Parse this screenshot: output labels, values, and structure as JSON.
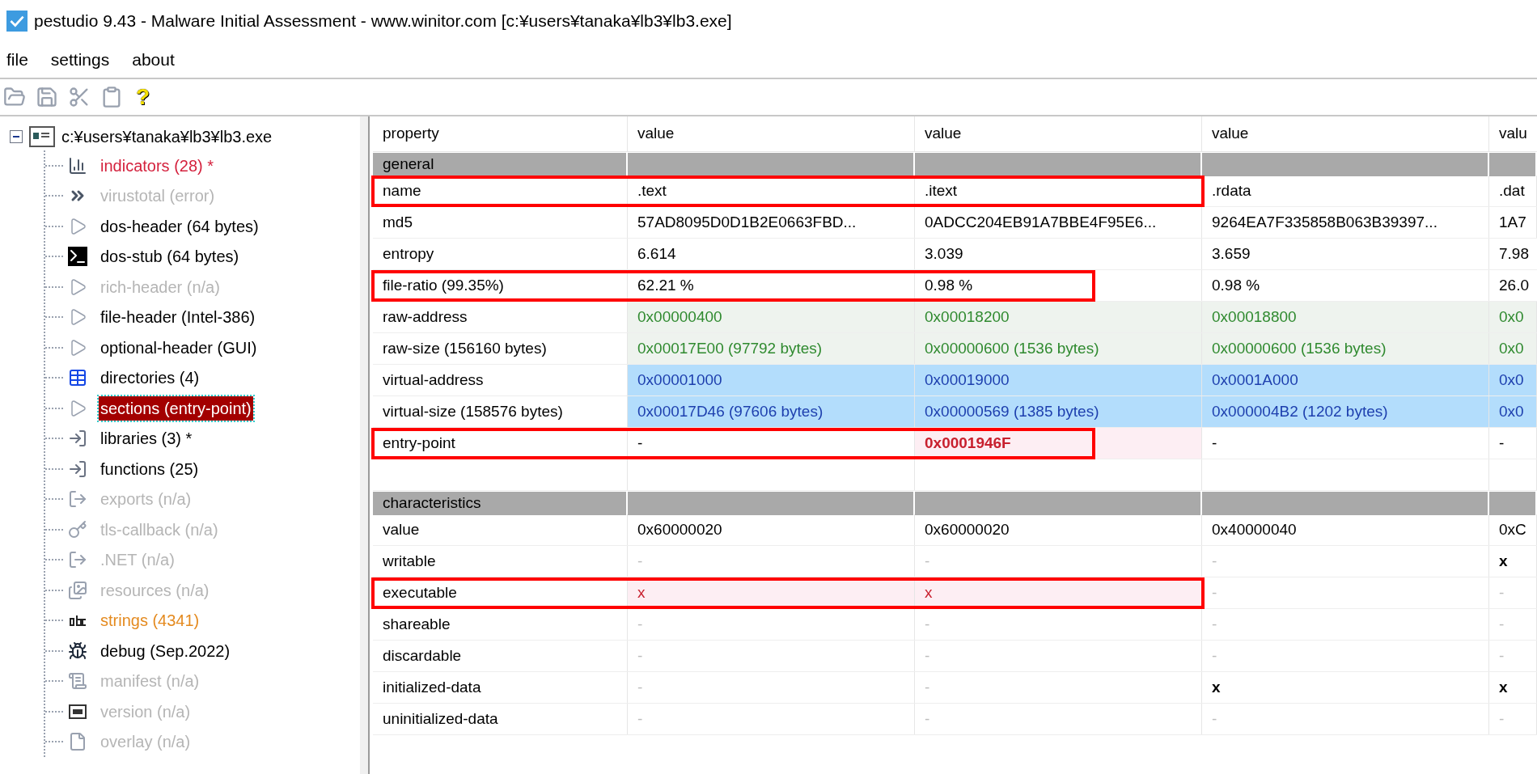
{
  "window": {
    "title": "pestudio 9.43 - Malware Initial Assessment - www.winitor.com [c:¥users¥tanaka¥lb3¥lb3.exe]"
  },
  "menu": [
    "file",
    "settings",
    "about"
  ],
  "toolbar": {
    "help_glyph": "?"
  },
  "tree": {
    "root": {
      "label": "c:¥users¥tanaka¥lb3¥lb3.exe",
      "expanded": true
    },
    "items": [
      {
        "label": "indicators (28) *",
        "kind": "chart",
        "color": "#d4213d",
        "selected": false
      },
      {
        "label": "virustotal (error)",
        "kind": "chevrons",
        "color": "#b5b5b5",
        "selected": false
      },
      {
        "label": "dos-header (64 bytes)",
        "kind": "expander",
        "color": "#000000",
        "selected": false
      },
      {
        "label": "dos-stub (64 bytes)",
        "kind": "console",
        "color": "#000000",
        "selected": false
      },
      {
        "label": "rich-header (n/a)",
        "kind": "expander",
        "color": "#b5b5b5",
        "selected": false
      },
      {
        "label": "file-header (Intel-386)",
        "kind": "expander",
        "color": "#000000",
        "selected": false
      },
      {
        "label": "optional-header (GUI)",
        "kind": "expander",
        "color": "#000000",
        "selected": false
      },
      {
        "label": "directories (4)",
        "kind": "grid",
        "color": "#000000",
        "selected": false
      },
      {
        "label": "sections (entry-point)",
        "kind": "expander",
        "selected": true
      },
      {
        "label": "libraries (3) *",
        "kind": "import",
        "color": "#000000",
        "selected": false
      },
      {
        "label": "functions (25)",
        "kind": "import",
        "color": "#000000",
        "selected": false
      },
      {
        "label": "exports (n/a)",
        "kind": "export",
        "color": "#b5b5b5",
        "selected": false
      },
      {
        "label": "tls-callback (n/a)",
        "kind": "key",
        "color": "#b5b5b5",
        "selected": false
      },
      {
        "label": ".NET (n/a)",
        "kind": "export",
        "color": "#b5b5b5",
        "selected": false
      },
      {
        "label": "resources (n/a)",
        "kind": "resources",
        "color": "#b5b5b5",
        "selected": false
      },
      {
        "label": "strings (4341)",
        "kind": "text",
        "color": "#e48a1f",
        "selected": false
      },
      {
        "label": "debug (Sep.2022)",
        "kind": "bug",
        "color": "#000000",
        "selected": false
      },
      {
        "label": "manifest (n/a)",
        "kind": "scroll",
        "color": "#b5b5b5",
        "selected": false
      },
      {
        "label": "version (n/a)",
        "kind": "version",
        "color": "#b5b5b5",
        "selected": false
      },
      {
        "label": "overlay (n/a)",
        "kind": "page",
        "color": "#b5b5b5",
        "selected": false
      }
    ]
  },
  "table": {
    "columns": [
      "property",
      "value",
      "value",
      "value",
      "valu"
    ],
    "rows": [
      {
        "kind": "group",
        "property": "general"
      },
      {
        "kind": "plain",
        "property": "name",
        "boxed": true,
        "wide": true,
        "cells": [
          {
            "text": ".text",
            "kind": "plain"
          },
          {
            "text": ".itext",
            "kind": "plain"
          },
          {
            "text": ".rdata",
            "kind": "plain"
          },
          {
            "text": ".dat",
            "kind": "plain"
          }
        ]
      },
      {
        "kind": "plain",
        "property": "md5",
        "boxed": false,
        "cells": [
          {
            "text": "57AD8095D0D1B2E0663FBD...",
            "kind": "plain"
          },
          {
            "text": "0ADCC204EB91A7BBE4F95E6...",
            "kind": "plain"
          },
          {
            "text": "9264EA7F335858B063B39397...",
            "kind": "plain"
          },
          {
            "text": "1A7",
            "kind": "plain"
          }
        ]
      },
      {
        "kind": "plain",
        "property": "entropy",
        "boxed": false,
        "cells": [
          {
            "text": "6.614",
            "kind": "plain"
          },
          {
            "text": "3.039",
            "kind": "plain"
          },
          {
            "text": "3.659",
            "kind": "plain"
          },
          {
            "text": "7.98",
            "kind": "plain"
          }
        ]
      },
      {
        "kind": "plain",
        "property": "file-ratio (99.35%)",
        "boxed": true,
        "wide": false,
        "cells": [
          {
            "text": "62.21 %",
            "kind": "plain"
          },
          {
            "text": "0.98 %",
            "kind": "plain"
          },
          {
            "text": "0.98 %",
            "kind": "plain"
          },
          {
            "text": "26.0",
            "kind": "plain"
          }
        ]
      },
      {
        "kind": "raw",
        "property": "raw-address",
        "boxed": false,
        "cells": [
          {
            "text": "0x00000400",
            "kind": "plain"
          },
          {
            "text": "0x00018200",
            "kind": "plain"
          },
          {
            "text": "0x00018800",
            "kind": "plain"
          },
          {
            "text": "0x0",
            "kind": "plain"
          }
        ]
      },
      {
        "kind": "raw",
        "property": "raw-size (156160 bytes)",
        "boxed": false,
        "cells": [
          {
            "text": "0x00017E00 (97792 bytes)",
            "kind": "plain"
          },
          {
            "text": "0x00000600 (1536 bytes)",
            "kind": "plain"
          },
          {
            "text": "0x00000600 (1536 bytes)",
            "kind": "plain"
          },
          {
            "text": "0x0",
            "kind": "plain"
          }
        ]
      },
      {
        "kind": "virtual",
        "property": "virtual-address",
        "boxed": false,
        "cells": [
          {
            "text": "0x00001000",
            "kind": "plain"
          },
          {
            "text": "0x00019000",
            "kind": "plain"
          },
          {
            "text": "0x0001A000",
            "kind": "plain"
          },
          {
            "text": "0x0",
            "kind": "plain"
          }
        ]
      },
      {
        "kind": "virtual",
        "property": "virtual-size (158576 bytes)",
        "boxed": false,
        "cells": [
          {
            "text": "0x00017D46 (97606 bytes)",
            "kind": "plain"
          },
          {
            "text": "0x00000569 (1385 bytes)",
            "kind": "plain"
          },
          {
            "text": "0x000004B2 (1202 bytes)",
            "kind": "plain"
          },
          {
            "text": "0x0",
            "kind": "plain"
          }
        ]
      },
      {
        "kind": "plain",
        "property": "entry-point",
        "boxed": true,
        "wide": false,
        "cells": [
          {
            "text": "-",
            "kind": "plain"
          },
          {
            "text": "0x0001946F",
            "kind": "alert"
          },
          {
            "text": "-",
            "kind": "plain"
          },
          {
            "text": "-",
            "kind": "plain"
          }
        ]
      },
      {
        "kind": "blank"
      },
      {
        "kind": "group",
        "property": "characteristics"
      },
      {
        "kind": "plain",
        "property": "value",
        "boxed": false,
        "cells": [
          {
            "text": "0x60000020",
            "kind": "plain"
          },
          {
            "text": "0x60000020",
            "kind": "plain"
          },
          {
            "text": "0x40000040",
            "kind": "plain"
          },
          {
            "text": "0xC",
            "kind": "plain"
          }
        ]
      },
      {
        "kind": "plain",
        "property": "writable",
        "boxed": false,
        "cells": [
          {
            "text": "-",
            "kind": "dim"
          },
          {
            "text": "-",
            "kind": "dim"
          },
          {
            "text": "-",
            "kind": "dim"
          },
          {
            "text": "x",
            "kind": "bold"
          }
        ]
      },
      {
        "kind": "plain",
        "property": "executable",
        "boxed": true,
        "wide": true,
        "cells": [
          {
            "text": "x",
            "kind": "flag"
          },
          {
            "text": "x",
            "kind": "flag"
          },
          {
            "text": "-",
            "kind": "dim"
          },
          {
            "text": "-",
            "kind": "dim"
          }
        ]
      },
      {
        "kind": "plain",
        "property": "shareable",
        "boxed": false,
        "cells": [
          {
            "text": "-",
            "kind": "dim"
          },
          {
            "text": "-",
            "kind": "dim"
          },
          {
            "text": "-",
            "kind": "dim"
          },
          {
            "text": "-",
            "kind": "dim"
          }
        ]
      },
      {
        "kind": "plain",
        "property": "discardable",
        "boxed": false,
        "cells": [
          {
            "text": "-",
            "kind": "dim"
          },
          {
            "text": "-",
            "kind": "dim"
          },
          {
            "text": "-",
            "kind": "dim"
          },
          {
            "text": "-",
            "kind": "dim"
          }
        ]
      },
      {
        "kind": "plain",
        "property": "initialized-data",
        "boxed": false,
        "cells": [
          {
            "text": "-",
            "kind": "dim"
          },
          {
            "text": "-",
            "kind": "dim"
          },
          {
            "text": "x",
            "kind": "bold"
          },
          {
            "text": "x",
            "kind": "bold"
          }
        ]
      },
      {
        "kind": "plain",
        "property": "uninitialized-data",
        "boxed": false,
        "cells": [
          {
            "text": "-",
            "kind": "dim"
          },
          {
            "text": "-",
            "kind": "dim"
          },
          {
            "text": "-",
            "kind": "dim"
          },
          {
            "text": "-",
            "kind": "dim"
          }
        ]
      }
    ]
  }
}
